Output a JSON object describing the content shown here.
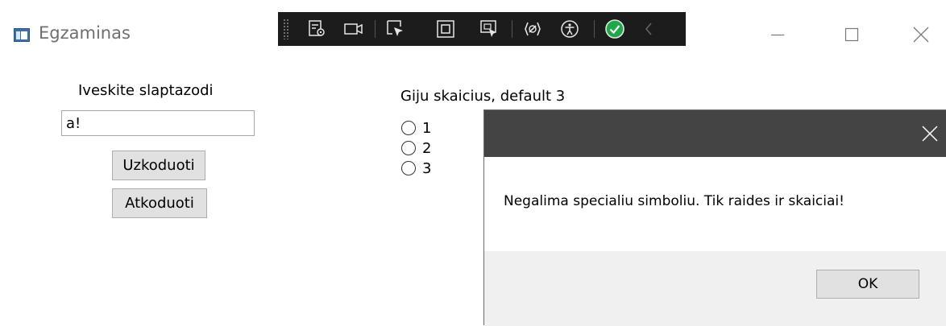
{
  "window": {
    "title": "Egzaminas",
    "icons": {
      "app": "app-window-icon",
      "minimize": "minimize-icon",
      "maximize": "maximize-icon",
      "close": "close-icon"
    }
  },
  "debug_toolbar": {
    "items": [
      "live-visual-tree-icon",
      "record-icon",
      "select-element-icon",
      "display-layout-adorners-icon",
      "track-focus-icon",
      "hot-reload-icon",
      "accessibility-icon",
      "binding-status-check-icon",
      "collapse-chevron-icon"
    ],
    "accent": "#1fa84a"
  },
  "password": {
    "label": "Iveskite slaptazodi",
    "value": "a!",
    "encode_button": "Uzkoduoti",
    "decode_button": "Atkoduoti"
  },
  "threads": {
    "label": "Giju skaicius, default 3",
    "options": [
      "1",
      "2",
      "3"
    ]
  },
  "message_box": {
    "text": "Negalima specialiu simboliu. Tik raides ir skaiciai!",
    "ok_label": "OK",
    "header_color": "#444444"
  }
}
